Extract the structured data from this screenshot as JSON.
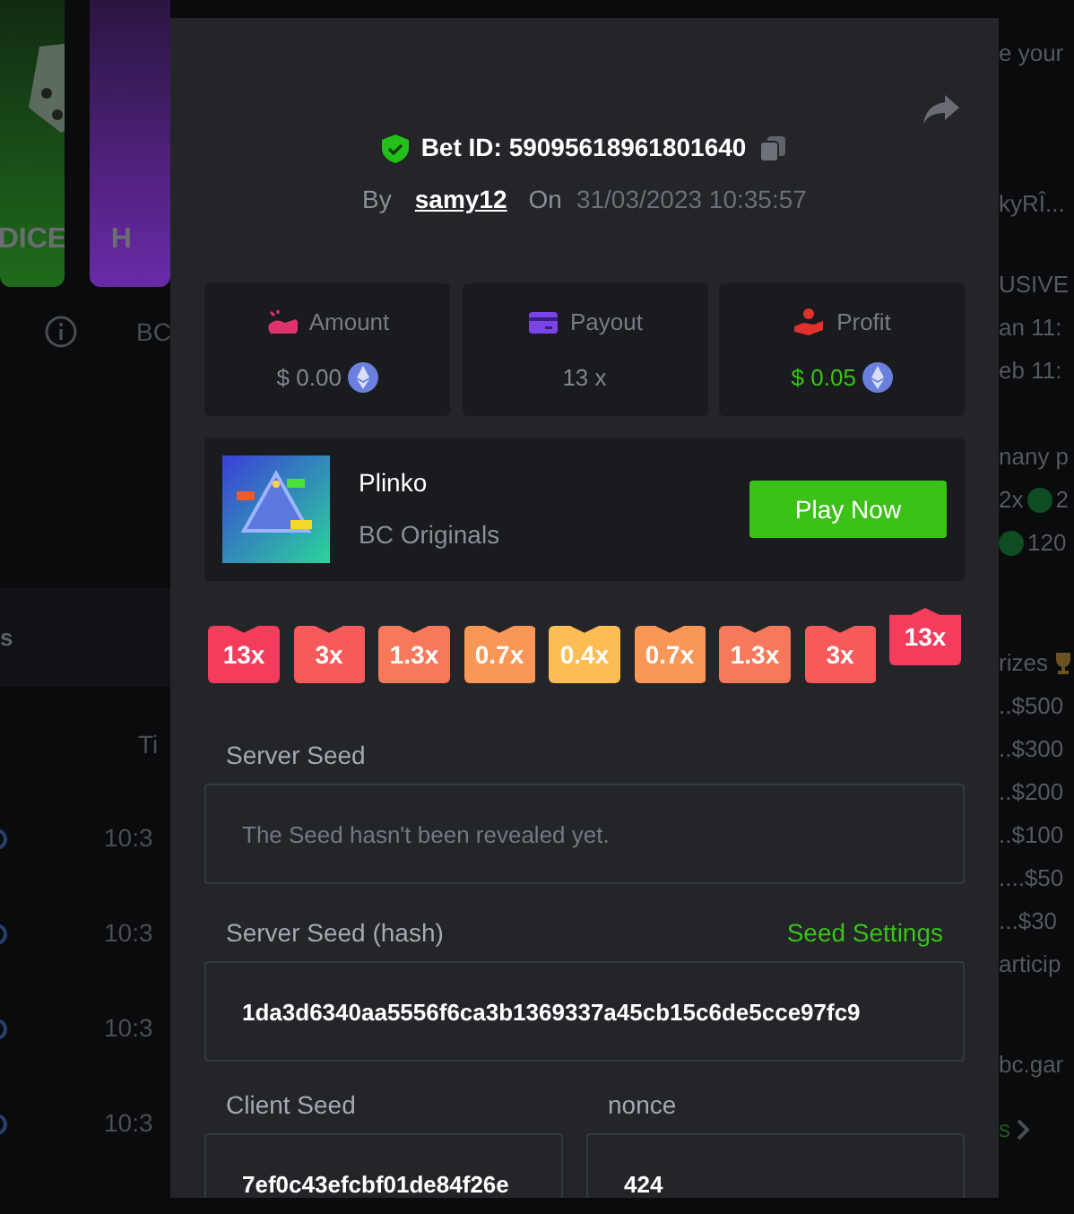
{
  "background": {
    "game_tiles": [
      {
        "title": "DICE",
        "color": "#1f6b1c"
      },
      {
        "title": "H",
        "color": "#6a2aa8"
      }
    ],
    "tile_caption": "BC",
    "tab": "s",
    "column_header": "Ti",
    "times": [
      "10:3",
      "10:3",
      "10:3",
      "10:3"
    ],
    "side_blocks": [
      [
        [
          {
            "kind": "text",
            "text": "e your"
          }
        ]
      ],
      [
        [
          {
            "kind": "text",
            "text": "kyRÎ..."
          }
        ]
      ],
      [
        [
          {
            "kind": "text",
            "text": "USIVE"
          }
        ],
        [
          {
            "kind": "text",
            "text": "an 11:"
          }
        ],
        [
          {
            "kind": "text",
            "text": "eb 11:"
          }
        ]
      ],
      [
        [
          {
            "kind": "text",
            "text": "nany p"
          }
        ],
        [
          {
            "kind": "text",
            "text": "2x"
          },
          {
            "kind": "dot"
          },
          {
            "kind": "text",
            "text": "2"
          }
        ],
        [
          {
            "kind": "dot"
          },
          {
            "kind": "text",
            "text": "120"
          }
        ]
      ],
      [
        [
          {
            "kind": "text",
            "text": "rizes"
          },
          {
            "kind": "trophy"
          }
        ],
        [
          {
            "kind": "text",
            "text": "..$500"
          }
        ],
        [
          {
            "kind": "text",
            "text": "..$300"
          }
        ],
        [
          {
            "kind": "text",
            "text": "..$200"
          }
        ],
        [
          {
            "kind": "text",
            "text": "..$100"
          }
        ],
        [
          {
            "kind": "text",
            "text": "....$50"
          }
        ],
        [
          {
            "kind": "text",
            "text": "...$30"
          }
        ],
        [
          {
            "kind": "text",
            "text": "articip"
          }
        ]
      ],
      [
        [
          {
            "kind": "text",
            "text": "bc.gar"
          }
        ]
      ],
      [
        [
          {
            "kind": "link",
            "text": "s"
          },
          {
            "kind": "chevron"
          }
        ]
      ]
    ]
  },
  "bet": {
    "label": "Bet ID: 59095618961801640",
    "by_label": "By",
    "user": "samy12",
    "on_label": "On",
    "date": "31/03/2023 10:35:57"
  },
  "stats": [
    {
      "kind": "amount",
      "label": "Amount",
      "value": "$ 0.00",
      "coin": true,
      "positive": false
    },
    {
      "kind": "payout",
      "label": "Payout",
      "value": "13 x",
      "coin": false,
      "positive": false
    },
    {
      "kind": "profit",
      "label": "Profit",
      "value": "$ 0.05",
      "coin": true,
      "positive": true
    }
  ],
  "game": {
    "name": "Plinko",
    "provider": "BC Originals",
    "button": "Play Now"
  },
  "multipliers": [
    {
      "label": "13x",
      "color": "#f43c5c",
      "selected": false
    },
    {
      "label": "3x",
      "color": "#f65a5a",
      "selected": false
    },
    {
      "label": "1.3x",
      "color": "#f7785a",
      "selected": false
    },
    {
      "label": "0.7x",
      "color": "#fa9656",
      "selected": false
    },
    {
      "label": "0.4x",
      "color": "#fdbd55",
      "selected": false
    },
    {
      "label": "0.7x",
      "color": "#fa9656",
      "selected": false
    },
    {
      "label": "1.3x",
      "color": "#f7785a",
      "selected": false
    },
    {
      "label": "3x",
      "color": "#f65a5a",
      "selected": false
    },
    {
      "label": "13x",
      "color": "#f43c5c",
      "selected": true
    }
  ],
  "server_seed": {
    "label": "Server Seed",
    "placeholder": "The Seed hasn't been revealed yet."
  },
  "server_seed_hash": {
    "label": "Server Seed (hash)",
    "link": "Seed Settings",
    "value": "1da3d6340aa5556f6ca3b1369337a45cb15c6de5cce97fc9"
  },
  "client_seed": {
    "label": "Client Seed",
    "value": "7ef0c43efcbf01de84f26e"
  },
  "nonce": {
    "label": "nonce",
    "value": "424"
  }
}
